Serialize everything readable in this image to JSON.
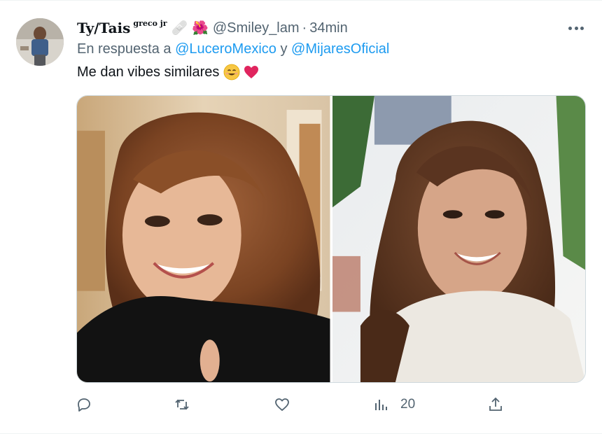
{
  "tweet": {
    "display_name": "Ty/Tais",
    "name_suffix": "greco jr",
    "name_emojis": [
      "🩹",
      "🌺"
    ],
    "handle": "@Smiley_lam",
    "separator": "·",
    "time": "34min",
    "reply_prefix": "En respuesta a",
    "reply_mentions": [
      "@LuceroMexico",
      "@MijaresOficial"
    ],
    "reply_joiner": "y",
    "text": "Me dan vibes similares",
    "text_emojis": [
      "face-with-tears-of-joy-smile",
      "red-heart"
    ],
    "media": [
      {
        "alt": "photo-left"
      },
      {
        "alt": "photo-right"
      }
    ],
    "actions": {
      "reply": {
        "icon": "reply-icon",
        "count": ""
      },
      "retweet": {
        "icon": "retweet-icon",
        "count": ""
      },
      "like": {
        "icon": "heart-icon",
        "count": ""
      },
      "views": {
        "icon": "analytics-icon",
        "count": "20"
      },
      "share": {
        "icon": "share-icon",
        "count": ""
      }
    }
  },
  "colors": {
    "text": "#0f1419",
    "secondary": "#536471",
    "link": "#1d9bf0",
    "border": "#cfd9de"
  }
}
